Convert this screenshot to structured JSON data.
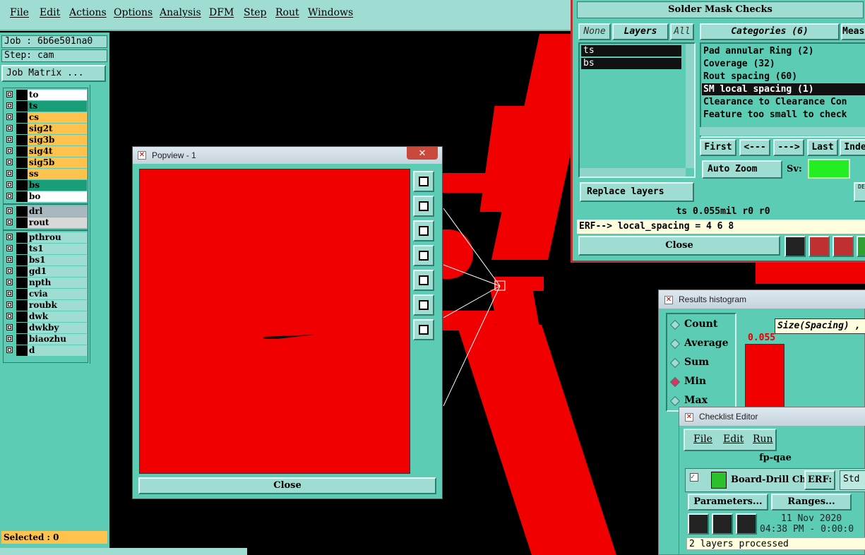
{
  "menu": {
    "items": [
      "File",
      "Edit",
      "Actions",
      "Options",
      "Analysis",
      "DFM",
      "Step",
      "Rout",
      "Windows"
    ]
  },
  "job": {
    "job_label": "Job : 6b6e501na0",
    "step_label": "Step: cam",
    "matrix_button": "Job Matrix ..."
  },
  "layers_board": [
    {
      "name": "to",
      "color": "#ffffff"
    },
    {
      "name": "ts",
      "color": "#1a9e7a"
    },
    {
      "name": "cs",
      "color": "#ffc34d"
    },
    {
      "name": "sig2t",
      "color": "#ffc34d"
    },
    {
      "name": "sig3b",
      "color": "#ffc34d"
    },
    {
      "name": "sig4t",
      "color": "#ffc34d"
    },
    {
      "name": "sig5b",
      "color": "#ffc34d"
    },
    {
      "name": "ss",
      "color": "#ffc34d"
    },
    {
      "name": "bs",
      "color": "#1a9e7a"
    },
    {
      "name": "bo",
      "color": "#ffffff"
    }
  ],
  "layers_drill": [
    {
      "name": "drl",
      "color": "#a8b8c0"
    },
    {
      "name": "rout",
      "color": "#d8d8d8"
    }
  ],
  "layers_misc": [
    "pthrou",
    "ts1",
    "bs1",
    "gd1",
    "npth",
    "cvia",
    "roubk",
    "dwk",
    "dwkby",
    "biaozhu",
    "d"
  ],
  "selected": "Selected : 0",
  "popview": {
    "title": "Popview - 1",
    "close": "Close"
  },
  "solder": {
    "title": "Solder Mask Checks",
    "none": "None",
    "layers": "Layers",
    "all": "All",
    "categories_tab": "Categories (6)",
    "meas_tab": "Meas",
    "layer_list": [
      "ts",
      "bs"
    ],
    "categories": [
      "Pad annular Ring (2)",
      "Coverage (32)",
      "Rout spacing (60)",
      "SM local spacing (1)",
      "Clearance to Clearance Con",
      "Feature too small to check"
    ],
    "nav": [
      "First",
      "<---",
      "--->",
      "Last",
      "Inde"
    ],
    "auto_zoom": "Auto Zoom",
    "sv": "Sv:",
    "replace": "Replace layers",
    "status": "ts 0.055mil  r0  r0",
    "erf": "ERF--> local_spacing = 4 6 8",
    "close": "Close"
  },
  "histogram": {
    "title": "Results histogram",
    "options": [
      "Count",
      "Average",
      "Sum",
      "Min",
      "Max"
    ],
    "selected": "Min",
    "size_label": "Size(Spacing) ,",
    "value": "0.055"
  },
  "checklist": {
    "title": "Checklist Editor",
    "menu": [
      "File",
      "Edit",
      "Run"
    ],
    "name": "fp-qae",
    "check": "Board-Drill Che",
    "erf": "ERF:",
    "std": "Std",
    "parameters": "Parameters...",
    "ranges": "Ranges...",
    "date": "11 Nov 2020",
    "time": "04:38 PM - 0:00:0",
    "processed": "2 layers processed"
  }
}
